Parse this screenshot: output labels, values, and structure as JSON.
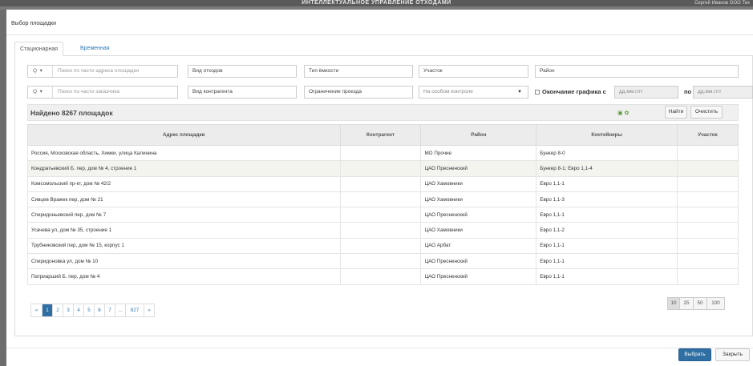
{
  "topbar": {
    "title": "ИНТЕЛЛЕКТУАЛЬНОЕ УПРАВЛЕНИЕ ОТХОДАМИ",
    "user": "Сергей Иванов OOO Тех"
  },
  "modal": {
    "title": "Выбор площадки"
  },
  "tabs": [
    "Стационарная",
    "Временная"
  ],
  "filters": {
    "address_search": {
      "icon": "Q",
      "placeholder": "Поиск по части адреса площадки"
    },
    "customer_search": {
      "icon": "Q",
      "placeholder": "Поиск по части заказчика"
    },
    "waste_type": "Вид отходов",
    "capacity_type": "Тип ёмкости",
    "section": "Участок",
    "district": "Район",
    "contractor_type": "Вид контрагента",
    "passage_limit": "Ограничение проезда",
    "special_control": "На особом контроле",
    "end_schedule_label": "Окончание графика с",
    "date_from": "дд.мм.гггг",
    "to_label": "по",
    "date_to": "дд.мм.гггг"
  },
  "found_text": "Найдено 8267 площадок",
  "buttons": {
    "find": "Найти",
    "clear": "Очистить",
    "select": "Выбрать",
    "close": "Закрыть"
  },
  "table": {
    "columns": [
      "Адрес площадки",
      "Контрагент",
      "Район",
      "Контейнеры",
      "Участок"
    ],
    "rows": [
      [
        "Россия, Московская область, Химки, улица Калинина",
        "",
        "МО Прочие",
        "Бункер 8-0",
        ""
      ],
      [
        "Кондратьевский Б. пер, дом № 4, строение 1",
        "",
        "ЦАО Пресненский",
        "Бункер 8-1; Евро 1,1-4",
        ""
      ],
      [
        "Комсомольский пр-кт, дом № 42/2",
        "",
        "ЦАО Хамовники",
        "Евро 1,1-1",
        ""
      ],
      [
        "Сивцев Вражек пер, дом № 21",
        "",
        "ЦАО Хамовники",
        "Евро 1,1-3",
        ""
      ],
      [
        "Спиридоньевский пер, дом № 7",
        "",
        "ЦАО Пресненский",
        "Евро 1,1-1",
        ""
      ],
      [
        "Усачева ул, дом № 35, строение 1",
        "",
        "ЦАО Хамовники",
        "Евро 1,1-2",
        ""
      ],
      [
        "Трубниковский пер, дом № 15, корпус 1",
        "",
        "ЦАО Арбат",
        "Евро 1,1-1",
        ""
      ],
      [
        "Спиридоновка ул, дом № 10",
        "",
        "ЦАО Пресненский",
        "Евро 1,1-1",
        ""
      ],
      [
        "Патриарший Б. пер, дом № 4",
        "",
        "ЦАО Пресненский",
        "Евро 1,1-1",
        ""
      ]
    ]
  },
  "pagination": [
    "«",
    "1",
    "2",
    "3",
    "4",
    "5",
    "6",
    "7",
    "...",
    "827",
    "»"
  ],
  "page_sizes": [
    "10",
    "25",
    "50",
    "100"
  ]
}
